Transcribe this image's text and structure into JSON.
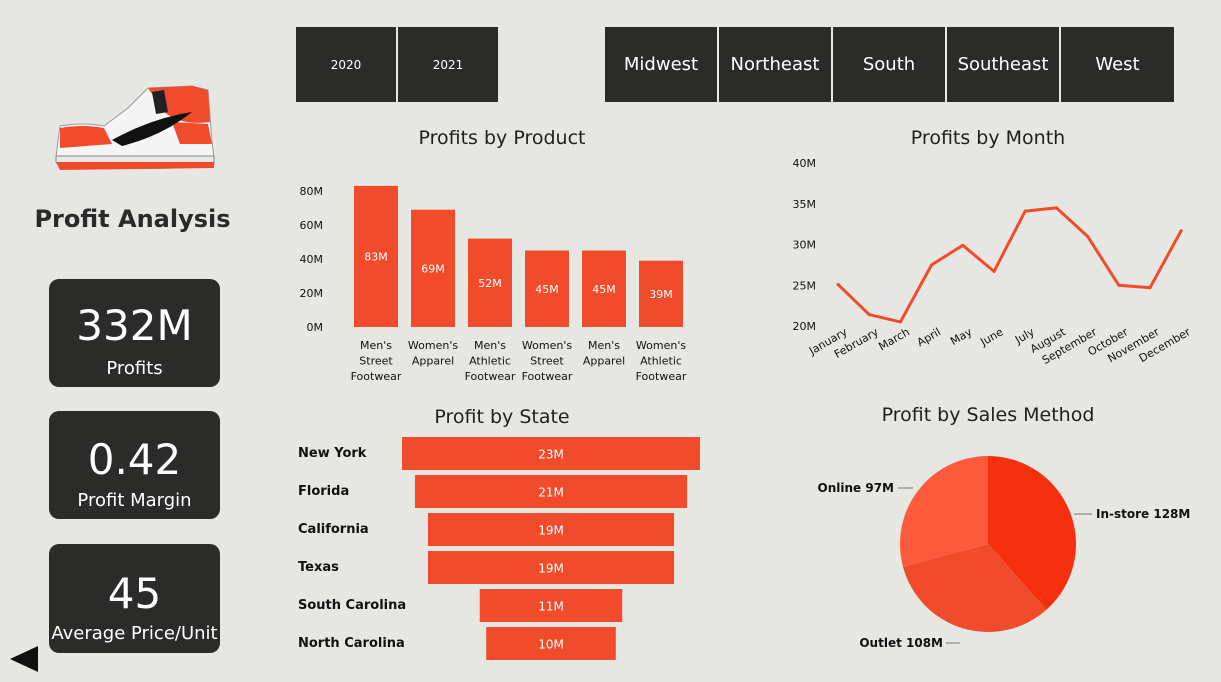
{
  "page": {
    "title": "Profit Analysis"
  },
  "colors": {
    "bar": "#f04b2b",
    "dark": "#2b2b29",
    "pie": [
      "#f5300f",
      "#f04b2b",
      "#fd5a3c"
    ]
  },
  "filters": {
    "years": [
      "2020",
      "2021"
    ],
    "regions": [
      "Midwest",
      "Northeast",
      "South",
      "Southeast",
      "West"
    ]
  },
  "kpis": [
    {
      "value": "332M",
      "label": "Profits"
    },
    {
      "value": "0.42",
      "label": "Profit Margin"
    },
    {
      "value": "45",
      "label": "Average Price/Unit"
    }
  ],
  "nav": {
    "back_icon": "back-arrow-icon"
  },
  "chart_data": [
    {
      "type": "bar",
      "title": "Profits by Product",
      "categories": [
        "Men's Street Footwear",
        "Women's Apparel",
        "Men's Athletic Footwear",
        "Women's Street Footwear",
        "Men's Apparel",
        "Women's Athletic Footwear"
      ],
      "category_lines": [
        [
          "Men's",
          "Street",
          "Footwear"
        ],
        [
          "Women's",
          "Apparel"
        ],
        [
          "Men's",
          "Athletic",
          "Footwear"
        ],
        [
          "Women's",
          "Street",
          "Footwear"
        ],
        [
          "Men's",
          "Apparel"
        ],
        [
          "Women's",
          "Athletic",
          "Footwear"
        ]
      ],
      "values": [
        83,
        69,
        52,
        45,
        45,
        39
      ],
      "data_labels": [
        "83M",
        "69M",
        "52M",
        "45M",
        "45M",
        "39M"
      ],
      "yticks": [
        "0M",
        "20M",
        "40M",
        "60M",
        "80M"
      ],
      "ylim": [
        0,
        80
      ]
    },
    {
      "type": "line",
      "title": "Profits by Month",
      "x": [
        "January",
        "February",
        "March",
        "April",
        "May",
        "June",
        "July",
        "August",
        "September",
        "October",
        "November",
        "December"
      ],
      "values": [
        25.1,
        21.4,
        20.5,
        27.5,
        29.9,
        26.7,
        34.1,
        34.5,
        31.0,
        25.0,
        24.7,
        31.7
      ],
      "yticks": [
        "20M",
        "25M",
        "30M",
        "35M",
        "40M"
      ],
      "ylim": [
        20,
        40
      ]
    },
    {
      "type": "bar",
      "orientation": "horizontal-funnel",
      "title": "Profit by State",
      "categories": [
        "New York",
        "Florida",
        "California",
        "Texas",
        "South Carolina",
        "North Carolina"
      ],
      "values": [
        23,
        21,
        19,
        19,
        11,
        10
      ],
      "data_labels": [
        "23M",
        "21M",
        "19M",
        "19M",
        "11M",
        "10M"
      ]
    },
    {
      "type": "pie",
      "title": "Profit by Sales Method",
      "categories": [
        "In-store",
        "Outlet",
        "Online"
      ],
      "values": [
        128,
        108,
        97
      ],
      "data_labels": [
        "In-store 128M",
        "Outlet 108M",
        "Online 97M"
      ]
    }
  ]
}
